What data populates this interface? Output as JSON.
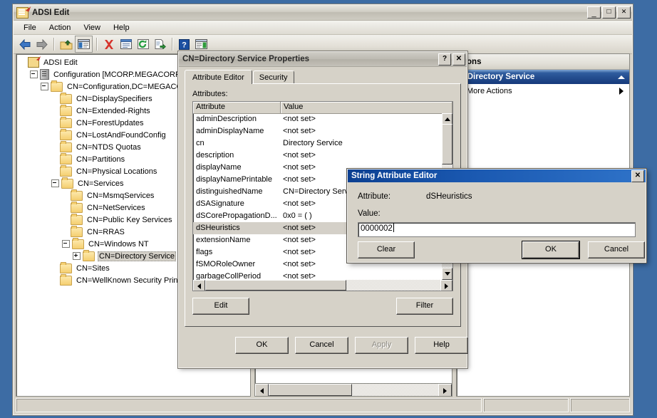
{
  "desktop": {
    "background_color": "#3d6ca4"
  },
  "mmc": {
    "title": "ADSI Edit",
    "window_buttons": {
      "minimize": "_",
      "maximize": "□",
      "close": "✕"
    },
    "menu": [
      {
        "label": "File"
      },
      {
        "label": "Action"
      },
      {
        "label": "View"
      },
      {
        "label": "Help"
      }
    ],
    "toolbar": [
      {
        "name": "back-icon",
        "tooltip": "Back"
      },
      {
        "name": "forward-icon",
        "tooltip": "Forward"
      },
      {
        "name": "up-one-level-icon",
        "tooltip": "Up One Level"
      },
      {
        "name": "show-hide-tree-icon",
        "tooltip": "Show/Hide Console Tree"
      },
      {
        "name": "delete-icon",
        "tooltip": "Delete"
      },
      {
        "name": "properties-icon",
        "tooltip": "Properties"
      },
      {
        "name": "refresh-icon",
        "tooltip": "Refresh"
      },
      {
        "name": "export-list-icon",
        "tooltip": "Export List"
      },
      {
        "name": "help-icon",
        "tooltip": "Help"
      },
      {
        "name": "show-hide-action-pane-icon",
        "tooltip": "Show/Hide Action Pane"
      }
    ],
    "tree": [
      {
        "label": "ADSI Edit",
        "indent": 0,
        "icon": "adsi-root-icon",
        "expander": "none"
      },
      {
        "label": "Configuration [MCORP.MEGACORP.LOC",
        "indent": 1,
        "icon": "server-icon",
        "expander": "minus"
      },
      {
        "label": "CN=Configuration,DC=MEGACORP",
        "indent": 2,
        "icon": "folder-icon",
        "expander": "minus"
      },
      {
        "label": "CN=DisplaySpecifiers",
        "indent": 3,
        "icon": "folder-icon",
        "expander": "none"
      },
      {
        "label": "CN=Extended-Rights",
        "indent": 3,
        "icon": "folder-icon",
        "expander": "none"
      },
      {
        "label": "CN=ForestUpdates",
        "indent": 3,
        "icon": "folder-icon",
        "expander": "none"
      },
      {
        "label": "CN=LostAndFoundConfig",
        "indent": 3,
        "icon": "folder-icon",
        "expander": "none"
      },
      {
        "label": "CN=NTDS Quotas",
        "indent": 3,
        "icon": "folder-icon",
        "expander": "none"
      },
      {
        "label": "CN=Partitions",
        "indent": 3,
        "icon": "folder-icon",
        "expander": "none"
      },
      {
        "label": "CN=Physical Locations",
        "indent": 3,
        "icon": "folder-icon",
        "expander": "none"
      },
      {
        "label": "CN=Services",
        "indent": 3,
        "icon": "folder-icon",
        "expander": "minus"
      },
      {
        "label": "CN=MsmqServices",
        "indent": 4,
        "icon": "folder-icon",
        "expander": "none"
      },
      {
        "label": "CN=NetServices",
        "indent": 4,
        "icon": "folder-icon",
        "expander": "none"
      },
      {
        "label": "CN=Public Key Services",
        "indent": 4,
        "icon": "folder-icon",
        "expander": "none"
      },
      {
        "label": "CN=RRAS",
        "indent": 4,
        "icon": "folder-icon",
        "expander": "none"
      },
      {
        "label": "CN=Windows NT",
        "indent": 4,
        "icon": "folder-icon",
        "expander": "minus"
      },
      {
        "label": "CN=Directory Service",
        "indent": 5,
        "icon": "folder-icon",
        "expander": "plus",
        "selected": true
      },
      {
        "label": "CN=Sites",
        "indent": 3,
        "icon": "folder-icon",
        "expander": "none"
      },
      {
        "label": "CN=WellKnown Security Princip",
        "indent": 3,
        "icon": "folder-icon",
        "expander": "none"
      }
    ],
    "actions": {
      "header": "tions",
      "group_title": "=Directory Service",
      "items": [
        {
          "label": "More Actions",
          "submenu": true
        }
      ]
    },
    "status_bar": {
      "main": "",
      "cell_b": "",
      "cell_c": ""
    }
  },
  "properties_dialog": {
    "title": "CN=Directory Service Properties",
    "help_button": "?",
    "close_button": "✕",
    "tabs": [
      {
        "label": "Attribute Editor",
        "active": true
      },
      {
        "label": "Security",
        "active": false
      }
    ],
    "attributes_label": "Attributes:",
    "columns": [
      "Attribute",
      "Value"
    ],
    "rows": [
      {
        "attribute": "adminDescription",
        "value": "<not set>"
      },
      {
        "attribute": "adminDisplayName",
        "value": "<not set>"
      },
      {
        "attribute": "cn",
        "value": "Directory Service"
      },
      {
        "attribute": "description",
        "value": "<not set>"
      },
      {
        "attribute": "displayName",
        "value": "<not set>"
      },
      {
        "attribute": "displayNamePrintable",
        "value": "<not set>"
      },
      {
        "attribute": "distinguishedName",
        "value": "CN=Directory Servic"
      },
      {
        "attribute": "dSASignature",
        "value": "<not set>"
      },
      {
        "attribute": "dSCorePropagationD...",
        "value": "0x0 = ( )"
      },
      {
        "attribute": "dSHeuristics",
        "value": "<not set>",
        "selected": true
      },
      {
        "attribute": "extensionName",
        "value": "<not set>"
      },
      {
        "attribute": "flags",
        "value": "<not set>"
      },
      {
        "attribute": "fSMORoleOwner",
        "value": "<not set>"
      },
      {
        "attribute": "garbageCollPeriod",
        "value": "<not set>"
      }
    ],
    "buttons": {
      "edit": "Edit",
      "filter": "Filter",
      "ok": "OK",
      "cancel": "Cancel",
      "apply": "Apply",
      "apply_disabled": true,
      "help": "Help"
    }
  },
  "string_attribute_editor": {
    "title": "String Attribute Editor",
    "close_button": "✕",
    "attribute_label": "Attribute:",
    "attribute_name": "dSHeuristics",
    "value_label": "Value:",
    "value": "0000002",
    "buttons": {
      "clear": "Clear",
      "ok": "OK",
      "cancel": "Cancel"
    }
  }
}
